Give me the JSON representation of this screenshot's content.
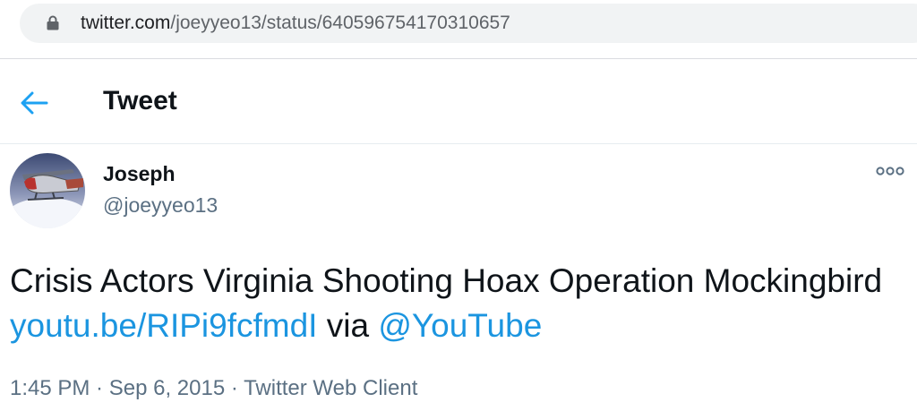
{
  "browser": {
    "url_host": "twitter.com",
    "url_path": "/joeyyeo13/status/640596754170310657",
    "lock_icon": "lock-icon"
  },
  "header": {
    "title": "Tweet",
    "back_icon": "arrow-left-icon",
    "accent_color": "#1da1f2"
  },
  "tweet": {
    "author": {
      "display_name": "Joseph",
      "handle": "@joeyyeo13"
    },
    "text": {
      "part1": "Crisis Actors Virginia Shooting Hoax Operation Mockingbird ",
      "link": "youtu.be/RIPi9fcfmdI",
      "part2": " via ",
      "mention": "@YouTube"
    },
    "time": "1:45 PM",
    "separator": " · ",
    "date": "Sep 6, 2015",
    "source": "Twitter Web Client",
    "more_icon": "more-options-icon",
    "link_color": "#1b95e0"
  }
}
